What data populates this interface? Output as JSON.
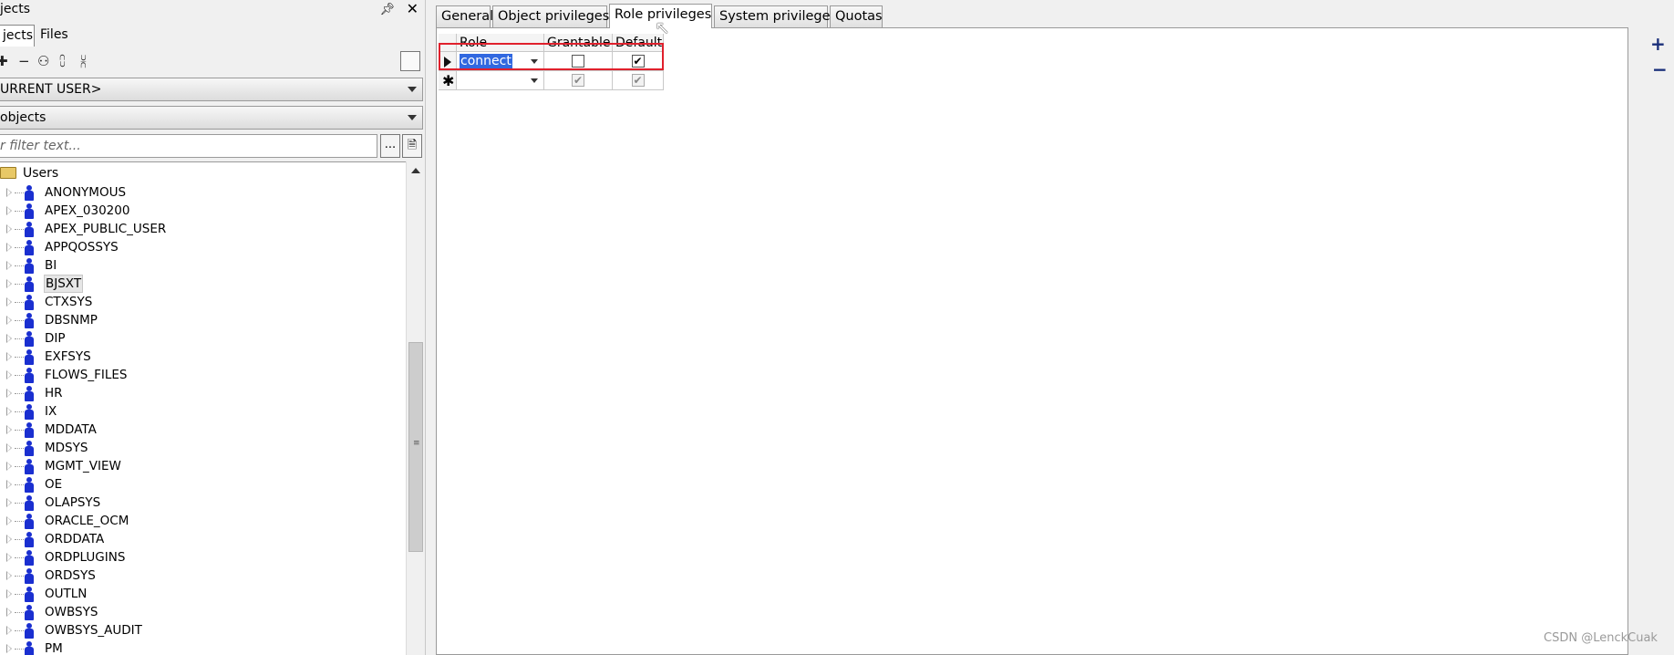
{
  "left_panel": {
    "title": "jects",
    "pin_icon": "pin-icon",
    "tabs": [
      {
        "label": "jects"
      },
      {
        "label": "Files"
      }
    ],
    "toolbar_icons": [
      "add-icon",
      "remove-icon",
      "find-icon",
      "collapse-icon",
      "expand-icon"
    ],
    "user_combo": "URRENT USER>",
    "objects_combo": "objects",
    "filter_placeholder": "r filter text...",
    "filter_button_label": "...",
    "tree": {
      "root_label": "Users",
      "items": [
        {
          "label": "ANONYMOUS"
        },
        {
          "label": "APEX_030200"
        },
        {
          "label": "APEX_PUBLIC_USER"
        },
        {
          "label": "APPQOSSYS"
        },
        {
          "label": "BI"
        },
        {
          "label": "BJSXT"
        },
        {
          "label": "CTXSYS"
        },
        {
          "label": "DBSNMP"
        },
        {
          "label": "DIP"
        },
        {
          "label": "EXFSYS"
        },
        {
          "label": "FLOWS_FILES"
        },
        {
          "label": "HR"
        },
        {
          "label": "IX"
        },
        {
          "label": "MDDATA"
        },
        {
          "label": "MDSYS"
        },
        {
          "label": "MGMT_VIEW"
        },
        {
          "label": "OE"
        },
        {
          "label": "OLAPSYS"
        },
        {
          "label": "ORACLE_OCM"
        },
        {
          "label": "ORDDATA"
        },
        {
          "label": "ORDPLUGINS"
        },
        {
          "label": "ORDSYS"
        },
        {
          "label": "OUTLN"
        },
        {
          "label": "OWBSYS"
        },
        {
          "label": "OWBSYS_AUDIT"
        },
        {
          "label": "PM"
        }
      ],
      "highlighted_item": "BJSXT"
    }
  },
  "tabs": [
    {
      "label": "General"
    },
    {
      "label": "Object privileges"
    },
    {
      "label": "Role privileges"
    },
    {
      "label": "System privileges"
    },
    {
      "label": "Quotas"
    }
  ],
  "active_tab": "Role privileges",
  "grid": {
    "columns": [
      "Role",
      "Grantable",
      "Default"
    ],
    "rows": [
      {
        "role": "connect",
        "grantable": false,
        "default": true
      }
    ],
    "new_row": {
      "grantable": true,
      "default": true
    }
  },
  "side_buttons": {
    "add": "+",
    "remove": "−"
  },
  "colors": {
    "selection": "#3168e0",
    "highlight_rect": "#e0202c",
    "user_icon": "#1a2fd0"
  },
  "watermark": "CSDN @LenckCuak"
}
